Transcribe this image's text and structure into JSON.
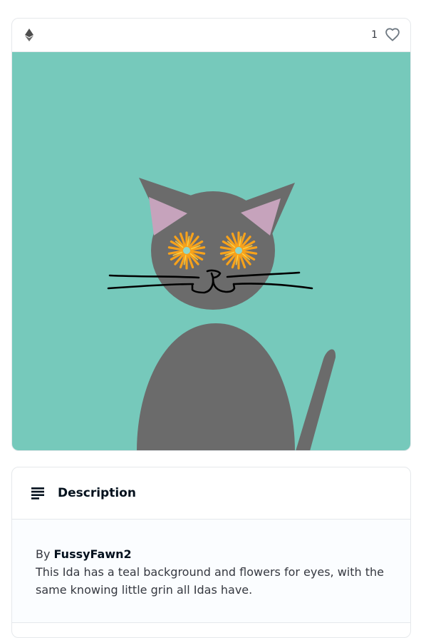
{
  "asset": {
    "chain_icon": "ethereum-icon",
    "favorites_count": "1",
    "favorite_icon": "heart-outline-icon",
    "background_color": "#76c9bb",
    "cat_color": "#6b6b6b",
    "ear_inner_color": "#c6a3bc"
  },
  "description": {
    "icon": "notes-icon",
    "title": "Description",
    "by_prefix": "By",
    "creator": "FussyFawn2",
    "text": "This Ida has a teal background and flowers for eyes, with the same knowing little grin all Idas have."
  }
}
